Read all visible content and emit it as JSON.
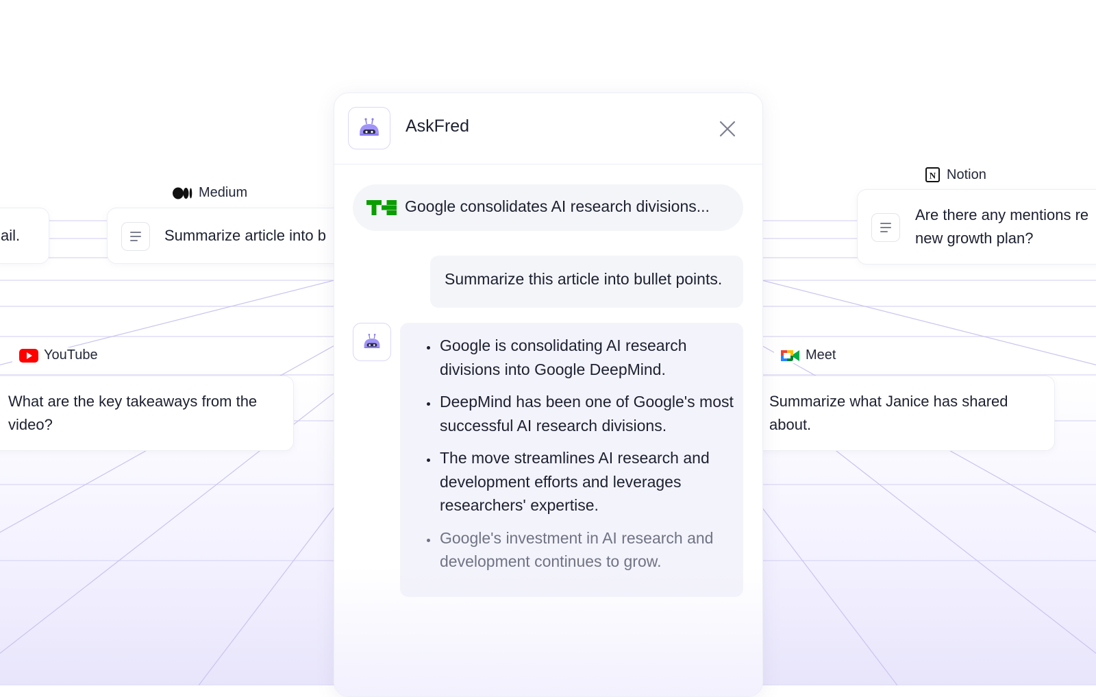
{
  "panel": {
    "title": "AskFred",
    "source_title": "Google consolidates AI research divisions...",
    "user_message": "Summarize this article into bullet points.",
    "bot_bullets": [
      "Google is consolidating AI research divisions into Google DeepMind.",
      "DeepMind has been one of Google's most successful AI research divisions.",
      "The move streamlines AI research and development efforts and leverages researchers' expertise.",
      "Google's investment in AI research and development continues to grow."
    ]
  },
  "cards": {
    "left_partial": {
      "text": "ail."
    },
    "medium": {
      "source": "Medium",
      "prompt": "Summarize article into b"
    },
    "youtube": {
      "source": "YouTube",
      "prompt": "What are the key takeaways from the video?"
    },
    "notion": {
      "source": "Notion",
      "prompt": "Are there any mentions re new growth plan?"
    },
    "meet": {
      "source": "Meet",
      "prompt": "Summarize what Janice has shared about."
    }
  },
  "colors": {
    "accent": "#8b7ff0",
    "techcrunch_green": "#0a9e01",
    "youtube_red": "#ff0000"
  },
  "icons": [
    "robot-avatar-icon",
    "close-icon",
    "techcrunch-logo-icon",
    "medium-logo-icon",
    "youtube-logo-icon",
    "notion-logo-icon",
    "google-meet-logo-icon",
    "document-lines-icon"
  ]
}
